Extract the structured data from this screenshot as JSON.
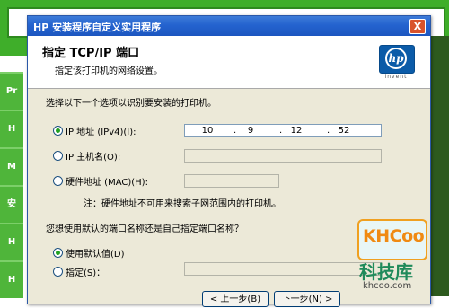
{
  "background": {
    "side_tabs": [
      "Pr",
      "H",
      "M",
      "安",
      "H",
      "H"
    ]
  },
  "dialog": {
    "title": "HP 安装程序自定义实用程序",
    "close_glyph": "X",
    "header_title": "指定 TCP/IP 端口",
    "header_subtitle": "指定该打印机的网络设置。",
    "logo_text": "hp",
    "logo_tagline": "invent",
    "section1_label": "选择以下一个选项以识别要安装的打印机。",
    "options": [
      {
        "label": "IP 地址 (IPv4)(I):",
        "selected": true
      },
      {
        "label": "IP 主机名(O):",
        "selected": false
      },
      {
        "label": "硬件地址 (MAC)(H):",
        "selected": false
      }
    ],
    "ip_octets": [
      "10",
      "9",
      "12",
      "52"
    ],
    "ip_separator": ".",
    "note": "注：硬件地址不可用来搜索子网范围内的打印机。",
    "section2_label": "您想使用默认的端口名称还是自己指定端口名称？",
    "port_options": [
      {
        "label": "使用默认值(D)",
        "selected": true
      },
      {
        "label": "指定(S)：",
        "selected": false
      }
    ],
    "buttons": [
      "< 上一步(B)",
      "下一步(N) >"
    ]
  },
  "watermark": {
    "logo": "KHCoo",
    "name": "科技库",
    "url": "khcoo.com"
  },
  "colors": {
    "accent_green": "#3fae2a",
    "title_blue": "#2463cf",
    "radio_dot": "#21a121"
  }
}
